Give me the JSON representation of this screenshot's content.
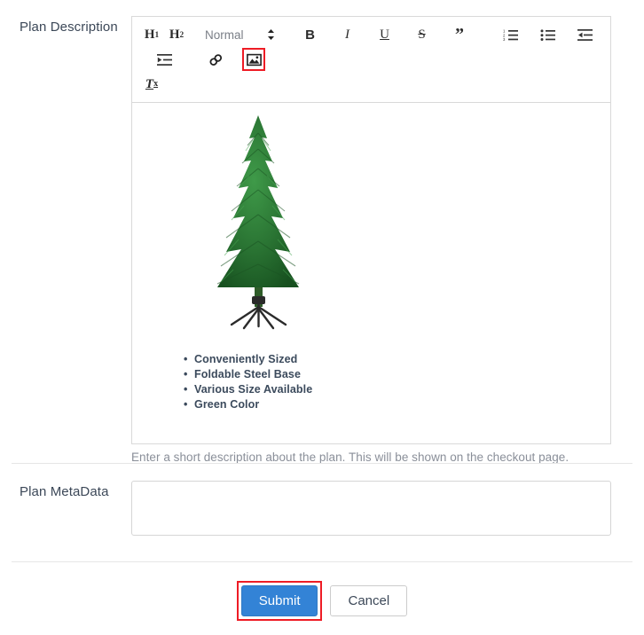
{
  "form": {
    "description_row": {
      "label": "Plan Description",
      "help_text": "Enter a short description about the plan. This will be shown on the checkout page."
    },
    "metadata_row": {
      "label": "Plan MetaData",
      "value": "",
      "placeholder": ""
    }
  },
  "editor": {
    "toolbar": {
      "h1_label": "H",
      "h1_sub": "1",
      "h2_label": "H",
      "h2_sub": "2",
      "format_picker_value": "Normal",
      "bold_label": "B",
      "italic_label": "I",
      "underline_label": "U",
      "strike_label": "S",
      "blockquote_label": "”",
      "clear_label": "T",
      "clear_sub": "x",
      "ordered_list_name": "ordered-list",
      "bullet_list_name": "bullet-list",
      "outdent_name": "outdent",
      "indent_name": "indent",
      "link_name": "link",
      "image_name": "image"
    },
    "content": {
      "image_alt": "Artificial green Christmas tree with black foldable steel stand",
      "bullets": [
        "Conveniently Sized",
        "Foldable Steel Base",
        "Various Size Available",
        "Green Color"
      ]
    }
  },
  "actions": {
    "submit_label": "Submit",
    "cancel_label": "Cancel"
  },
  "colors": {
    "primary_button": "#3383d6",
    "highlight_outline": "#ee1c25",
    "label_text": "#3c4858",
    "help_text": "#8a8f99",
    "border": "#d9d9d9",
    "tree_green_dark": "#1c5a27",
    "tree_green_mid": "#2c7a36",
    "tree_green_light": "#3d9647",
    "tree_stand": "#2b2b2b"
  }
}
